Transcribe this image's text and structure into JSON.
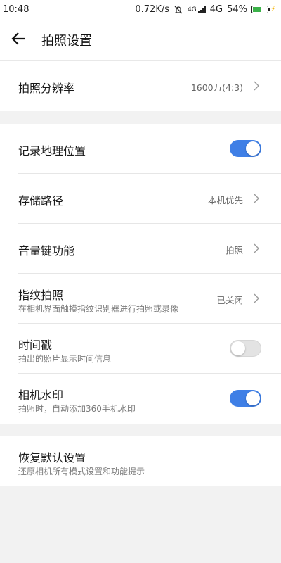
{
  "status_bar": {
    "time": "10:48",
    "speed": "0.72K/s",
    "network_small": "4G",
    "network": "4G",
    "battery": "54%",
    "battery_level": 0.54,
    "icons": [
      "mute-bell-icon",
      "signal-icon",
      "battery-icon",
      "charging-icon"
    ]
  },
  "header": {
    "back_icon": "arrow-left-icon",
    "title": "拍照设置"
  },
  "sections": {
    "resolution": {
      "label": "拍照分辨率",
      "value": "1600万(4:3)"
    },
    "settings": {
      "location": {
        "label": "记录地理位置",
        "enabled": true
      },
      "storage": {
        "label": "存储路径",
        "value": "本机优先"
      },
      "volume_key": {
        "label": "音量键功能",
        "value": "拍照"
      },
      "fingerprint": {
        "label": "指纹拍照",
        "sub": "在相机界面触摸指纹识别器进行拍照或录像",
        "value": "已关闭"
      },
      "timestamp": {
        "label": "时间戳",
        "sub": "拍出的照片显示时间信息",
        "enabled": false
      },
      "watermark": {
        "label": "相机水印",
        "sub": "拍照时，自动添加360手机水印",
        "enabled": true
      }
    },
    "reset": {
      "label": "恢复默认设置",
      "sub": "还原相机所有模式设置和功能提示"
    }
  },
  "colors": {
    "toggle_on": "#3f7fe6",
    "toggle_off": "#e3e3e3",
    "background": "#f2f2f2"
  }
}
